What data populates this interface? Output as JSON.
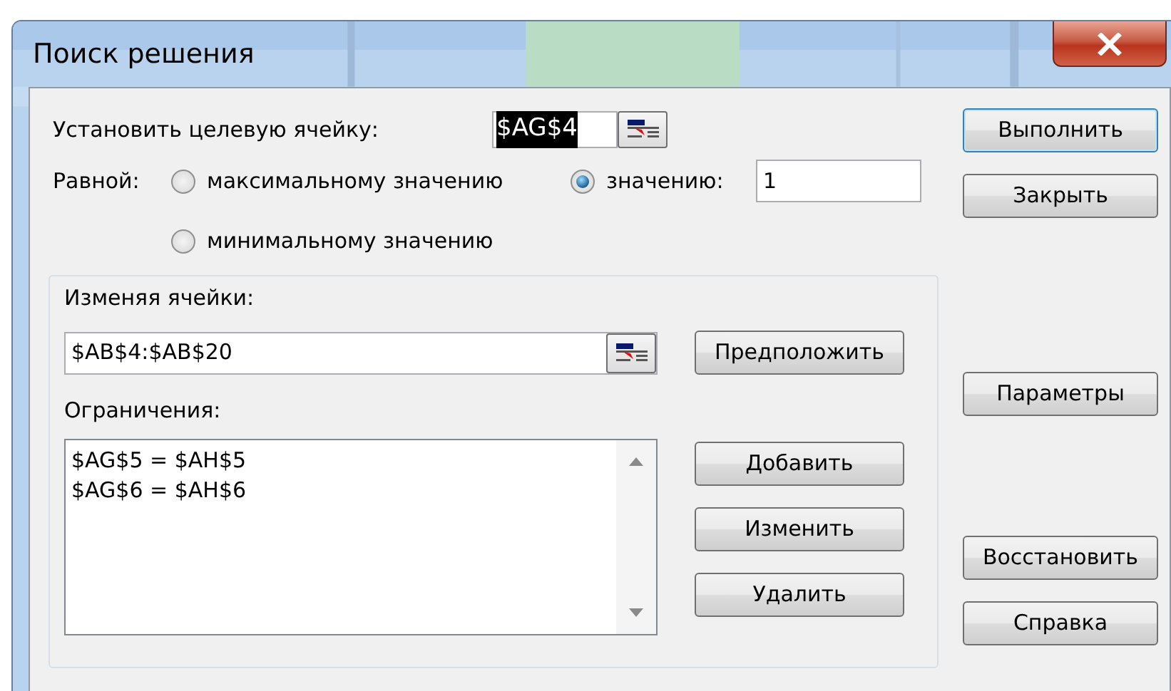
{
  "window": {
    "title": "Поиск решения"
  },
  "target": {
    "label": "Установить целевую ячейку:",
    "value": "$AG$4"
  },
  "equal_to": {
    "label": "Равной:",
    "options": [
      {
        "label": "максимальному значению",
        "selected": false,
        "kind": "plain"
      },
      {
        "label": "значению:",
        "selected": true,
        "kind": "value"
      },
      {
        "label": "минимальному значению",
        "selected": false,
        "kind": "plain"
      }
    ],
    "value": "1"
  },
  "changing": {
    "label": "Изменяя ячейки:",
    "value": "$AB$4:$AB$20",
    "button": "Предположить"
  },
  "constraints": {
    "label": "Ограничения:",
    "items": [
      "$AG$5 = $AH$5",
      "$AG$6 = $AH$6"
    ],
    "buttons": [
      "Добавить",
      "Изменить",
      "Удалить"
    ]
  },
  "side_buttons": [
    "Выполнить",
    "Закрыть",
    "Параметры",
    "Восстановить",
    "Справка"
  ]
}
